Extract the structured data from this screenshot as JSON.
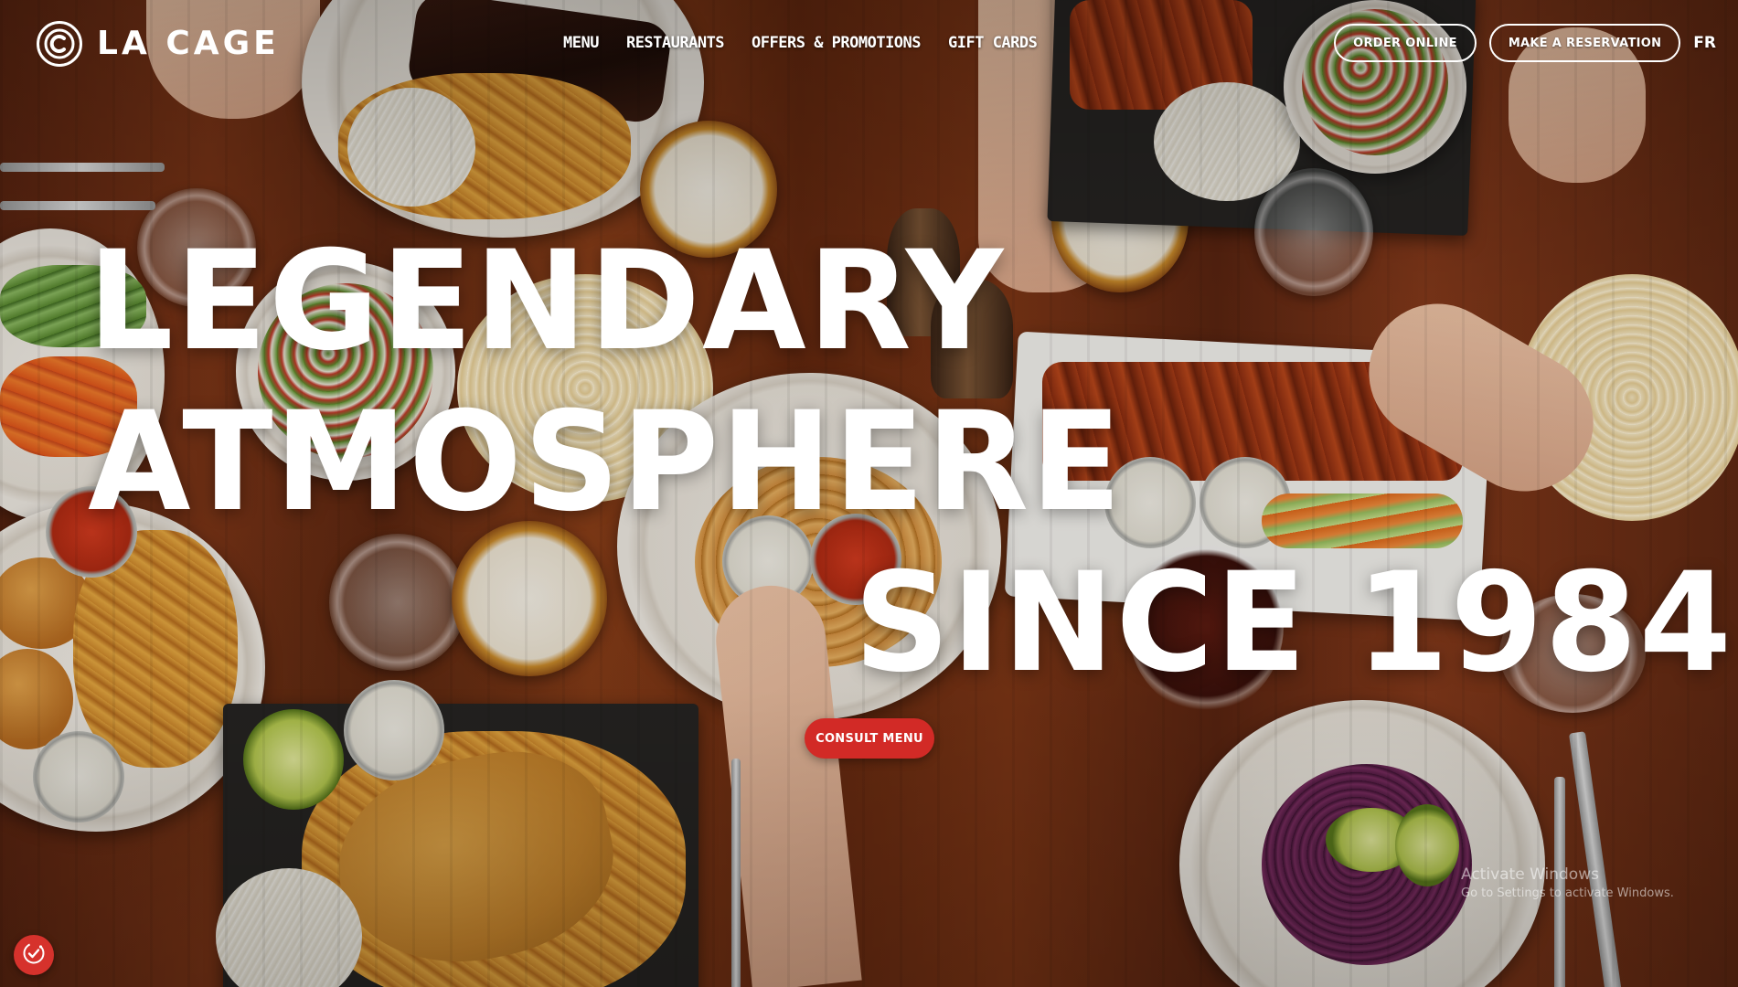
{
  "brand": {
    "name": "LA CAGE",
    "logo_icon": "circle-c-logo"
  },
  "nav": {
    "items": [
      {
        "label": "MENU"
      },
      {
        "label": "RESTAURANTS"
      },
      {
        "label": "OFFERS & PROMOTIONS"
      },
      {
        "label": "GIFT CARDS"
      }
    ]
  },
  "header_actions": {
    "order_online": "ORDER ONLINE",
    "reservation": "MAKE A RESERVATION",
    "language": "FR"
  },
  "hero": {
    "line1": "LEGENDARY",
    "line2": "ATMOSPHERE",
    "line3": "SINCE 1984",
    "cta_label": "CONSULT MENU"
  },
  "cookie_button": {
    "icon": "cookie-settings-icon"
  },
  "os_watermark": {
    "title": "Activate Windows",
    "subtitle": "Go to Settings to activate Windows."
  },
  "colors": {
    "accent": "#d22a26",
    "text": "#ffffff"
  }
}
